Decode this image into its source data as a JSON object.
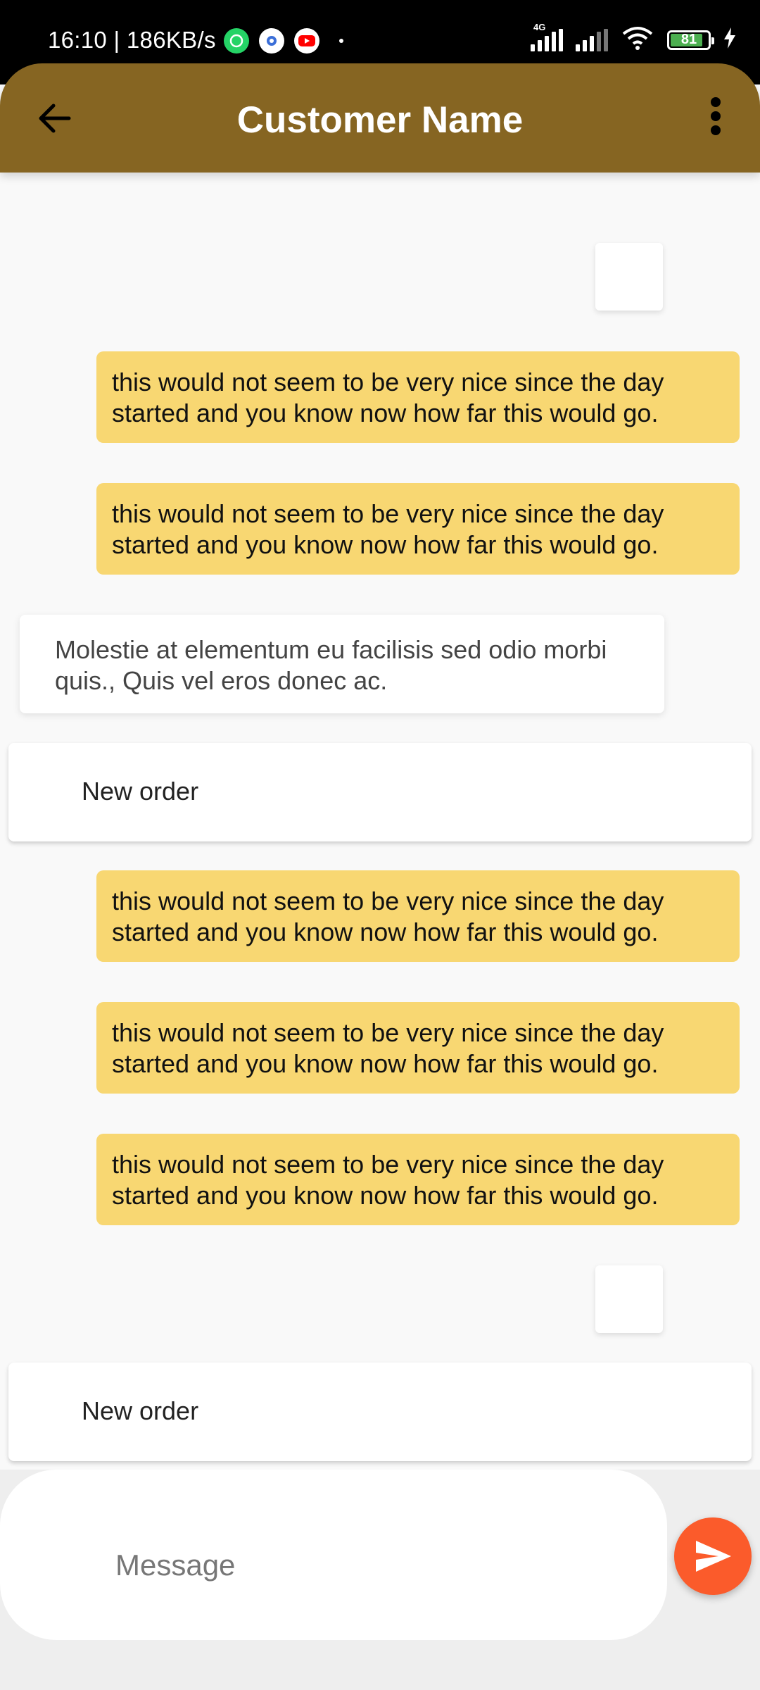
{
  "status_bar": {
    "time_speed": "16:10 | 186KB/s",
    "network_label": "4G",
    "battery": "81"
  },
  "app_bar": {
    "title": "Customer Name"
  },
  "messages": {
    "out_text": "this would not seem to be very nice since the day started and you know now how far this would go.",
    "in_text": "Molestie at elementum eu facilisis sed odio morbi quis., Quis vel eros donec ac.",
    "order_label": "New order"
  },
  "composer": {
    "placeholder": "Message"
  },
  "colors": {
    "app_bar": "#866522",
    "outgoing_bubble": "#f8d772",
    "send_button": "#fb5b2b"
  },
  "icons": {
    "back": "arrow-left-icon",
    "menu": "more-vert-icon",
    "send": "send-icon"
  }
}
